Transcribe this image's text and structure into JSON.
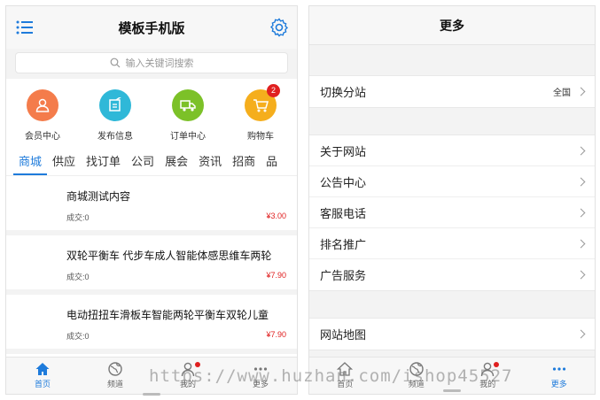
{
  "left": {
    "header": {
      "title": "模板手机版"
    },
    "search": {
      "placeholder": "输入关键词搜索"
    },
    "quick_links": [
      {
        "label": "会员中心",
        "icon": "user-icon",
        "color": "#f47c4b"
      },
      {
        "label": "发布信息",
        "icon": "edit-icon",
        "color": "#2fb8d8"
      },
      {
        "label": "订单中心",
        "icon": "truck-icon",
        "color": "#7cc128"
      },
      {
        "label": "购物车",
        "icon": "cart-icon",
        "color": "#f5ae1d",
        "badge": "2"
      }
    ],
    "tabs": [
      "商城",
      "供应",
      "找订单",
      "公司",
      "展会",
      "资讯",
      "招商",
      "品"
    ],
    "products": [
      {
        "name": "商城测试内容",
        "deals": "成交:0",
        "price": "¥3.00"
      },
      {
        "name": "双轮平衡车 代步车成人智能体感思维车两轮",
        "deals": "成交:0",
        "price": "¥7.90"
      },
      {
        "name": "电动扭扭车滑板车智能两轮平衡车双轮儿童",
        "deals": "成交:0",
        "price": "¥7.90"
      }
    ],
    "bottom_nav": [
      {
        "label": "首页",
        "icon": "home-icon"
      },
      {
        "label": "频道",
        "icon": "globe-icon"
      },
      {
        "label": "我的",
        "icon": "person-icon"
      },
      {
        "label": "更多",
        "icon": "more-icon"
      }
    ]
  },
  "right": {
    "header": {
      "title": "更多"
    },
    "region": {
      "label": "切换分站",
      "value": "全国"
    },
    "about_items": [
      "关于网站",
      "公告中心",
      "客服电话",
      "排名推广",
      "广告服务"
    ],
    "sitemap": {
      "label": "网站地图"
    },
    "bottom_nav": [
      {
        "label": "首页",
        "icon": "home-icon"
      },
      {
        "label": "频道",
        "icon": "globe-icon"
      },
      {
        "label": "我的",
        "icon": "person-icon"
      },
      {
        "label": "更多",
        "icon": "more-icon"
      }
    ]
  },
  "watermark": "https://www.huzhan.com/ishop45527",
  "colors": {
    "accent": "#1e7bdb",
    "price": "#e02020",
    "badge": "#e02020"
  }
}
